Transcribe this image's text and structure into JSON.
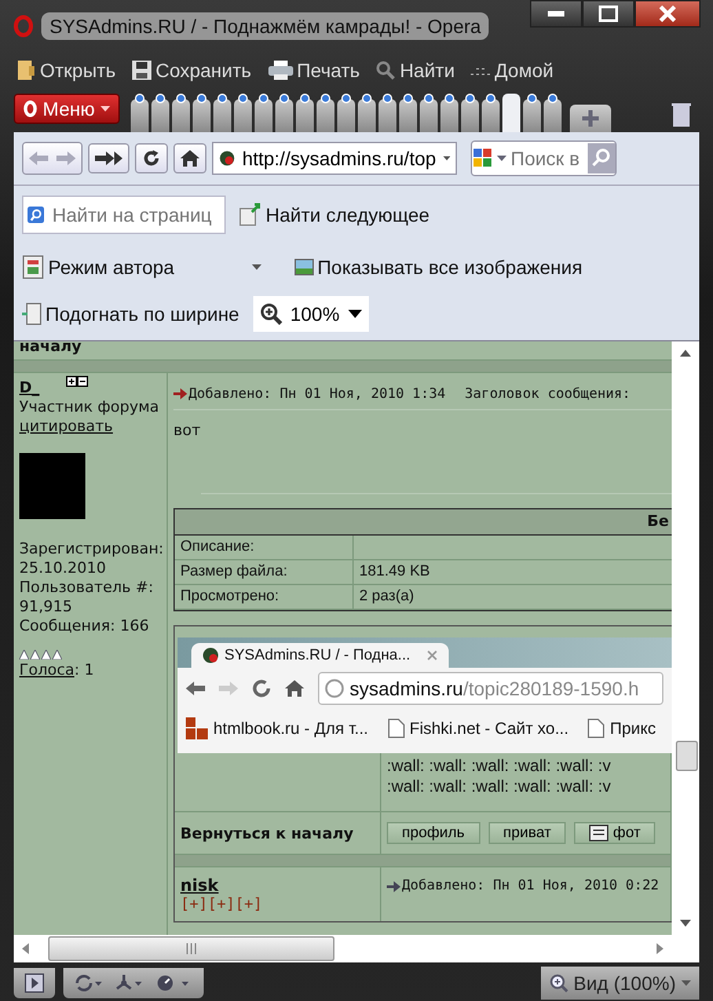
{
  "window": {
    "title": "SYSAdmins.RU / - Поднажмём камрады! - Opera"
  },
  "toolbar": [
    {
      "kind": "open",
      "label": "Открыть"
    },
    {
      "kind": "save",
      "label": "Сохранить"
    },
    {
      "kind": "print",
      "label": "Печать"
    },
    {
      "kind": "find",
      "label": "Найти"
    },
    {
      "kind": "home",
      "label": "Домой"
    }
  ],
  "tab_bar": {
    "menu_label": "Меню",
    "tabs": [
      {
        "selected": false
      },
      {
        "selected": false
      },
      {
        "selected": false
      },
      {
        "selected": false
      },
      {
        "selected": false
      },
      {
        "selected": false
      },
      {
        "selected": false
      },
      {
        "selected": false
      },
      {
        "selected": false
      },
      {
        "selected": false
      },
      {
        "selected": false
      },
      {
        "selected": false
      },
      {
        "selected": false
      },
      {
        "selected": false
      },
      {
        "selected": false
      },
      {
        "selected": false
      },
      {
        "selected": false
      },
      {
        "selected": false
      },
      {
        "selected": true
      },
      {
        "selected": false
      },
      {
        "selected": false
      }
    ]
  },
  "address_bar": {
    "url": "http://sysadmins.ru/top",
    "search_placeholder": "Поиск в"
  },
  "find_bar": {
    "placeholder": "Найти на страниц",
    "next_label": "Найти следующее"
  },
  "view_bar": {
    "author_mode": "Режим автора",
    "show_images": "Показывать все изображения",
    "fit_width": "Подогнать по ширине",
    "zoom": "100%"
  },
  "forum": {
    "top_row": "началу",
    "post": {
      "author": "D_",
      "rank": "Участник форума",
      "quote_link": "цитировать",
      "profile_lines": [
        "Зарегистрирован:",
        "25.10.2010",
        "Пользователь #:",
        "91,915",
        "Сообщения: 166"
      ],
      "stars": 4,
      "votes_link": "Голоса",
      "votes_count": ": 1",
      "posted": "Добавлено: Пн 01 Ноя, 2010 1:34",
      "subject_label": "Заголовок сообщения:",
      "body": "вот",
      "attachment": {
        "header": "Бе",
        "rows": [
          {
            "label": "Описание:",
            "value": ""
          },
          {
            "label": "Размер файла:",
            "value": "181.49 KB"
          },
          {
            "label": "Просмотрено:",
            "value": "2 раз(а)"
          }
        ]
      },
      "screenshot": {
        "tab_title": "SYSAdmins.RU / - Подна...",
        "url_host": "sysadmins.ru",
        "url_path": "/topic280189-1590.h",
        "bookmarks": [
          "htmlbook.ru - Для т...",
          "Fishki.net - Сайт хо...",
          "Прикс"
        ]
      },
      "wall_lines": [
        ":wall: :wall: :wall: :wall: :wall: :v",
        ":wall: :wall: :wall: :wall: :wall: :v"
      ],
      "back_link": "Вернуться к началу",
      "buttons": [
        "профиль",
        "приват",
        "фот"
      ]
    },
    "next_post": {
      "author": "nisk",
      "marks": "[+][+][+]",
      "posted": "Добавлено: Пн 01 Ноя, 2010 0:22"
    }
  },
  "status_bar": {
    "view": "Вид (100%)"
  }
}
